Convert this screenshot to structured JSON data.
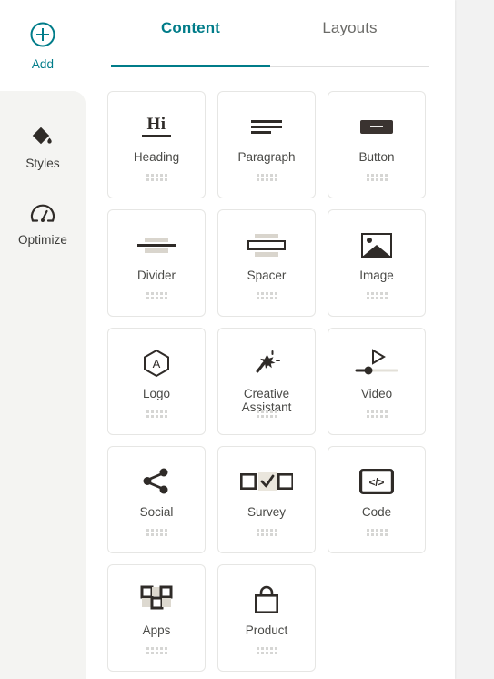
{
  "app": {
    "accent_color": "#007c89",
    "panel_background": "#ffffff",
    "canvas_background": "#f2f2f2",
    "rail_background": "#f4f4f2",
    "icon_dark": "#2f2b28"
  },
  "rail": {
    "add": {
      "label": "Add",
      "icon": "plus-circle-icon"
    },
    "items": [
      {
        "label": "Styles",
        "icon": "paint-drop-icon"
      },
      {
        "label": "Optimize",
        "icon": "speedometer-icon"
      }
    ]
  },
  "tabs": [
    {
      "label": "Content",
      "active": true
    },
    {
      "label": "Layouts",
      "active": false
    }
  ],
  "blocks": [
    {
      "label": "Heading",
      "icon": "heading-icon",
      "handle": "drag-handle-icon"
    },
    {
      "label": "Paragraph",
      "icon": "paragraph-icon",
      "handle": "drag-handle-icon"
    },
    {
      "label": "Button",
      "icon": "button-icon",
      "handle": "drag-handle-icon"
    },
    {
      "label": "Divider",
      "icon": "divider-icon",
      "handle": "drag-handle-icon"
    },
    {
      "label": "Spacer",
      "icon": "spacer-icon",
      "handle": "drag-handle-icon"
    },
    {
      "label": "Image",
      "icon": "image-icon",
      "handle": "drag-handle-icon"
    },
    {
      "label": "Logo",
      "icon": "logo-hexagon-icon",
      "handle": "drag-handle-icon"
    },
    {
      "label": "Creative Assistant",
      "icon": "magic-wand-icon",
      "handle": "drag-handle-icon"
    },
    {
      "label": "Video",
      "icon": "video-play-slider-icon",
      "handle": "drag-handle-icon"
    },
    {
      "label": "Social",
      "icon": "share-icon",
      "handle": "drag-handle-icon"
    },
    {
      "label": "Survey",
      "icon": "survey-checkbox-icon",
      "handle": "drag-handle-icon"
    },
    {
      "label": "Code",
      "icon": "code-brackets-icon",
      "handle": "drag-handle-icon"
    },
    {
      "label": "Apps",
      "icon": "apps-grid-icon",
      "handle": "drag-handle-icon"
    },
    {
      "label": "Product",
      "icon": "shopping-bag-icon",
      "handle": "drag-handle-icon"
    }
  ],
  "logo_icon_letter": "A",
  "code_icon_text": "</>"
}
